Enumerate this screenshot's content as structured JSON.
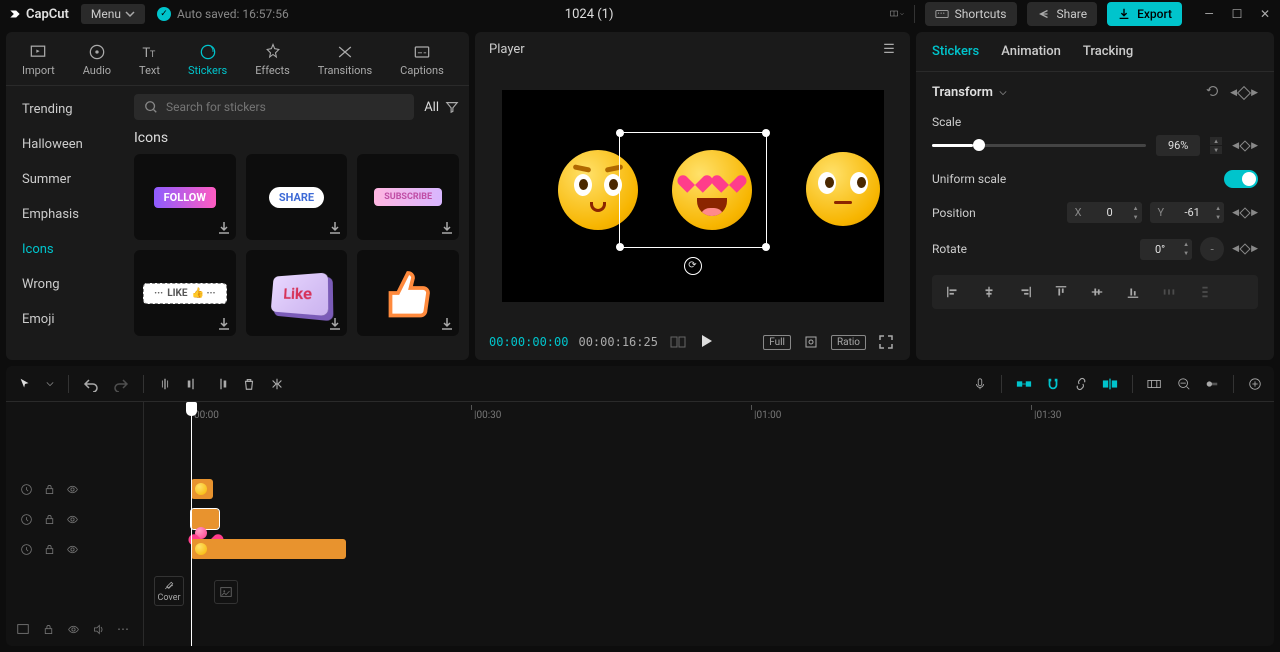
{
  "app": {
    "name": "CapCut",
    "menu": "Menu",
    "autosave": "Auto saved: 16:57:56",
    "title": "1024 (1)"
  },
  "topbar": {
    "shortcuts": "Shortcuts",
    "share": "Share",
    "export": "Export"
  },
  "media_tabs": [
    "Import",
    "Audio",
    "Text",
    "Stickers",
    "Effects",
    "Transitions",
    "Captions"
  ],
  "categories": [
    "Trending",
    "Halloween",
    "Summer",
    "Emphasis",
    "Icons",
    "Wrong",
    "Emoji"
  ],
  "search": {
    "placeholder": "Search for stickers",
    "filter": "All"
  },
  "section_title": "Icons",
  "stickers": [
    "FOLLOW",
    "SHARE",
    "SUBSCRIBE",
    "LIKE",
    "Like",
    ""
  ],
  "player": {
    "title": "Player",
    "tc1": "00:00:00:00",
    "tc2": "00:00:16:25",
    "full": "Full",
    "ratio": "Ratio"
  },
  "inspector": {
    "tabs": [
      "Stickers",
      "Animation",
      "Tracking"
    ],
    "transform": "Transform",
    "scale": "Scale",
    "scale_val": "96%",
    "uniform": "Uniform scale",
    "position": "Position",
    "pos_x_label": "X",
    "pos_x": "0",
    "pos_y_label": "Y",
    "pos_y": "-61",
    "rotate": "Rotate",
    "rotate_val": "0°"
  },
  "timeline": {
    "marks": [
      "00:00",
      "00:30",
      "01:00",
      "01:30"
    ],
    "cover": "Cover"
  }
}
